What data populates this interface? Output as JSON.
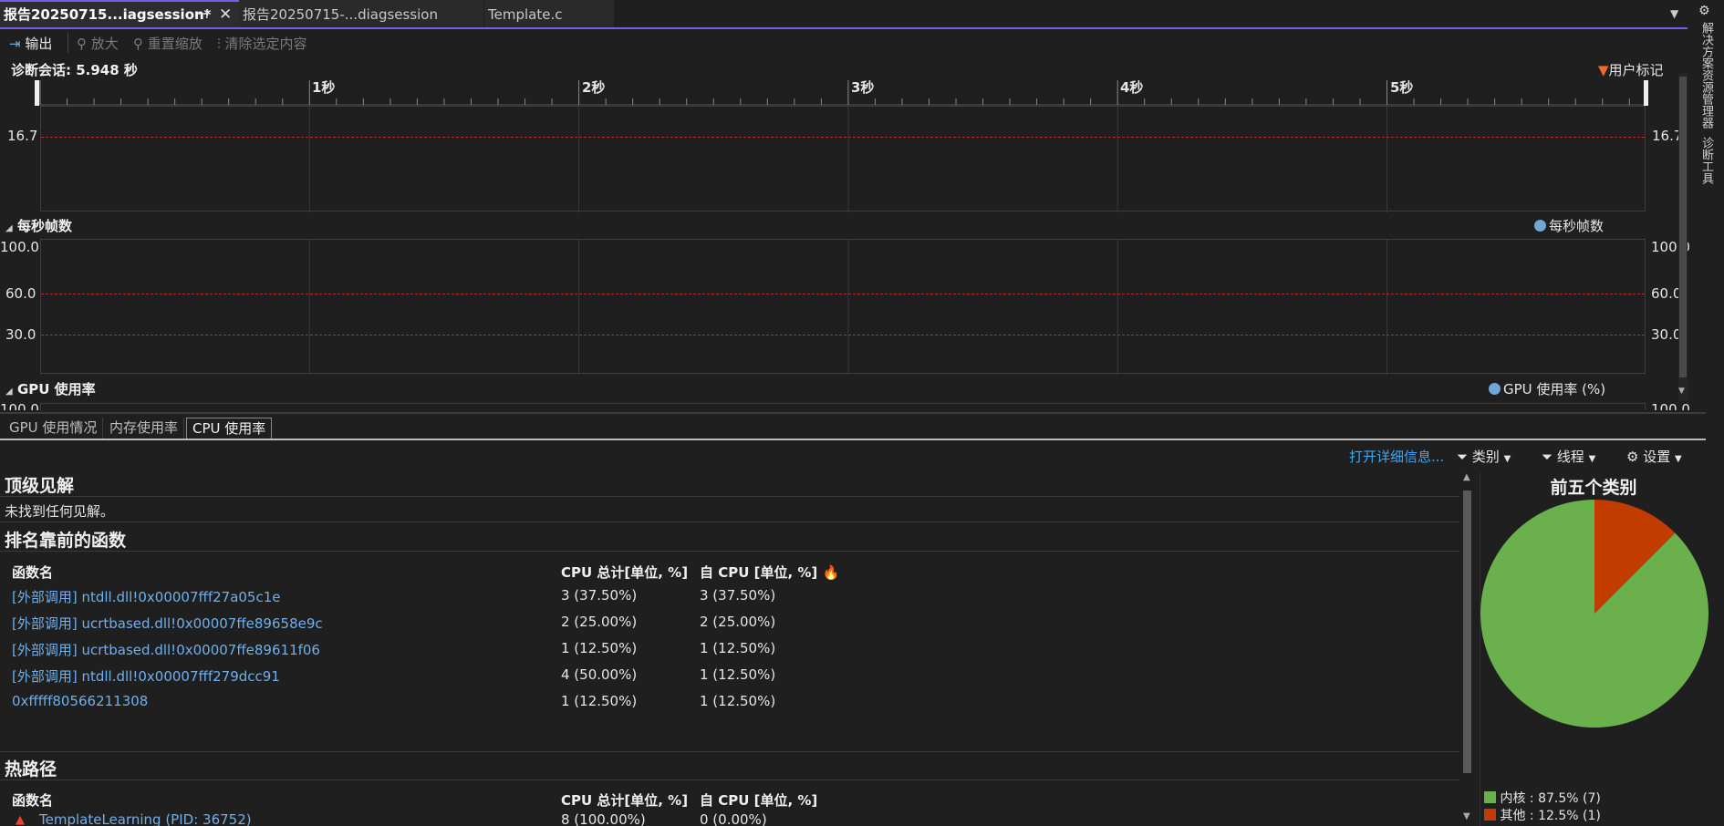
{
  "tabs": [
    {
      "label": "报告20250715...iagsession*",
      "active": true
    },
    {
      "label": "报告20250715-...diagsession",
      "active": false
    },
    {
      "label": "Template.c",
      "active": false
    }
  ],
  "side_panel": {
    "item1": "解决方案资源管理器",
    "item2": "诊断工具"
  },
  "toolbar": {
    "output": "输出",
    "zoom_in": "放大",
    "reset_zoom": "重置缩放",
    "clear_selection": "清除选定内容"
  },
  "session": {
    "label": "诊断会话: 5.948 秒",
    "user_marks": "用户标记"
  },
  "ruler": {
    "ticks": [
      "1秒",
      "2秒",
      "3秒",
      "4秒",
      "5秒"
    ]
  },
  "frame_panel": {
    "value_left": "16.7",
    "value_right": "16.7"
  },
  "fps_panel": {
    "title": "每秒帧数",
    "legend": "每秒帧数",
    "y_labels": [
      "100.0",
      "60.0",
      "30.0"
    ]
  },
  "gpu_panel": {
    "title": "GPU 使用率",
    "legend": "GPU 使用率 (%)",
    "y_label": "100.0"
  },
  "bottom_tabs": [
    "GPU 使用情况",
    "内存使用率",
    "CPU 使用率"
  ],
  "filters": {
    "open_details": "打开详细信息...",
    "category": "类别",
    "thread": "线程",
    "settings": "设置"
  },
  "top_insights": {
    "title": "顶级见解",
    "empty": "未找到任何见解。"
  },
  "top_functions": {
    "title": "排名靠前的函数",
    "headers": [
      "函数名",
      "CPU 总计[单位, %]",
      "自 CPU [单位, %]"
    ],
    "rows": [
      {
        "name": "[外部调用] ntdll.dll!0x00007fff27a05c1e",
        "total": "3 (37.50%)",
        "self": "3 (37.50%)"
      },
      {
        "name": "[外部调用] ucrtbased.dll!0x00007ffe89658e9c",
        "total": "2 (25.00%)",
        "self": "2 (25.00%)"
      },
      {
        "name": "[外部调用] ucrtbased.dll!0x00007ffe89611f06",
        "total": "1 (12.50%)",
        "self": "1 (12.50%)"
      },
      {
        "name": "[外部调用] ntdll.dll!0x00007fff279dcc91",
        "total": "4 (50.00%)",
        "self": "1 (12.50%)"
      },
      {
        "name": "0xfffff80566211308",
        "total": "1 (12.50%)",
        "self": "1 (12.50%)"
      }
    ]
  },
  "hot_path": {
    "title": "热路径",
    "headers": [
      "函数名",
      "CPU 总计[单位, %]",
      "自 CPU [单位, %]"
    ],
    "row": {
      "name": "TemplateLearning (PID: 36752)",
      "total": "8 (100.00%)",
      "self": "0 (0.00%)"
    }
  },
  "top_categories": {
    "title": "前五个类别",
    "slices": [
      {
        "label": "内核 : 87.5% (7)",
        "fraction": 0.875,
        "color": "#6ab04c"
      },
      {
        "label": "其他 : 12.5% (1)",
        "fraction": 0.125,
        "color": "#c23c00"
      }
    ]
  },
  "colors": {
    "accent": "#7160e8",
    "threshold": "#c0392b",
    "link": "#6fb0ec",
    "legend_blue": "#6fa8d6"
  }
}
